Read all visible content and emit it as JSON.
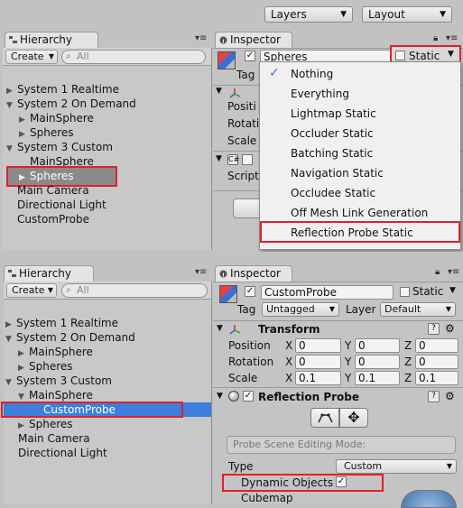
{
  "toolbar": {
    "layers_label": "Layers",
    "layout_label": "Layout"
  },
  "top": {
    "hierarchy": {
      "tab_label": "Hierarchy",
      "create_label": "Create",
      "search_placeholder": "All",
      "items": [
        {
          "label": "System 1 Realtime"
        },
        {
          "label": "System 2 On Demand"
        },
        {
          "label": "MainSphere"
        },
        {
          "label": "Spheres"
        },
        {
          "label": "System 3 Custom"
        },
        {
          "label": "MainSphere"
        },
        {
          "label": "Spheres"
        },
        {
          "label": "Main Camera"
        },
        {
          "label": "Directional Light"
        },
        {
          "label": "CustomProbe"
        }
      ]
    },
    "inspector": {
      "tab_label": "Inspector",
      "object_name": "Spheres",
      "static_label": "Static",
      "tag_label": "Tag",
      "partial_labels": [
        "Positi",
        "Rotati",
        "Scale",
        "Script"
      ],
      "static_menu": [
        "Nothing",
        "Everything",
        "Lightmap Static",
        "Occluder Static",
        "Batching Static",
        "Navigation Static",
        "Occludee Static",
        "Off Mesh Link Generation",
        "Reflection Probe Static"
      ]
    }
  },
  "bottom": {
    "hierarchy": {
      "tab_label": "Hierarchy",
      "create_label": "Create",
      "search_placeholder": "All",
      "items": [
        {
          "label": "System 1 Realtime"
        },
        {
          "label": "System 2 On Demand"
        },
        {
          "label": "MainSphere"
        },
        {
          "label": "Spheres"
        },
        {
          "label": "System 3 Custom"
        },
        {
          "label": "MainSphere"
        },
        {
          "label": "CustomProbe"
        },
        {
          "label": "Spheres"
        },
        {
          "label": "Main Camera"
        },
        {
          "label": "Directional Light"
        }
      ]
    },
    "inspector": {
      "tab_label": "Inspector",
      "object_name": "CustomProbe",
      "static_label": "Static",
      "tag_label": "Tag",
      "tag_value": "Untagged",
      "layer_label": "Layer",
      "layer_value": "Default",
      "transform": {
        "title": "Transform",
        "position": {
          "label": "Position",
          "x": "0",
          "y": "0",
          "z": "0"
        },
        "rotation": {
          "label": "Rotation",
          "x": "0",
          "y": "0",
          "z": "0"
        },
        "scale": {
          "label": "Scale",
          "x": "0.1",
          "y": "0.1",
          "z": "0.1"
        },
        "axis_x": "X",
        "axis_y": "Y",
        "axis_z": "Z"
      },
      "reflection_probe": {
        "title": "Reflection Probe",
        "mode_label": "Probe Scene Editing Mode:",
        "type_label": "Type",
        "type_value": "Custom",
        "dynamic_objects_label": "Dynamic Objects",
        "cubemap_label": "Cubemap"
      }
    }
  },
  "colors": {
    "highlight_red": "#e0202a",
    "selection_blue": "#3c7fdc"
  }
}
